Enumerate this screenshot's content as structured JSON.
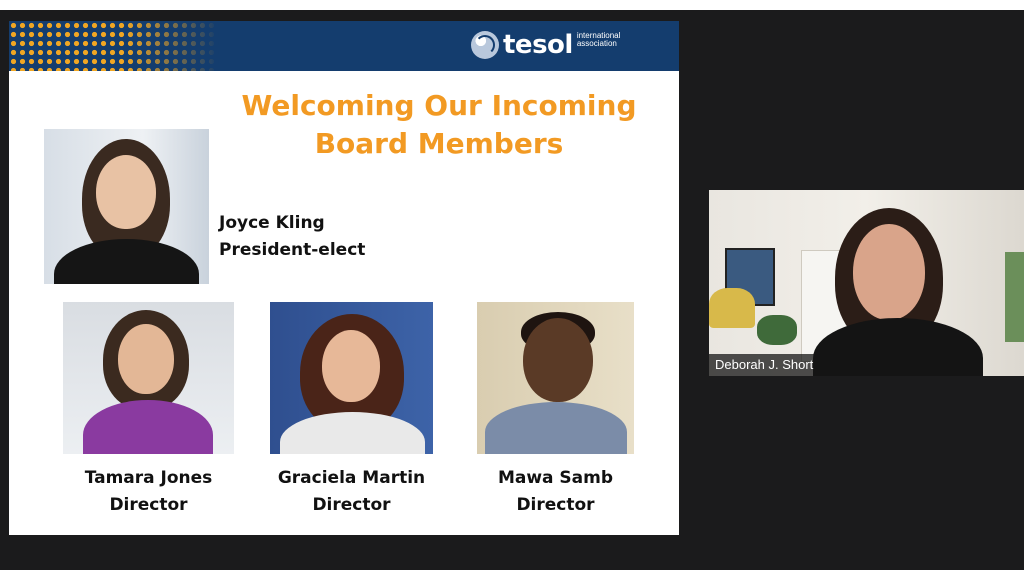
{
  "slide": {
    "logo": {
      "word": "tesol",
      "subtitle": "international association"
    },
    "title": "Welcoming Our Incoming Board Members",
    "featured": {
      "name": "Joyce Kling",
      "role": "President-elect"
    },
    "members": [
      {
        "name": "Tamara Jones",
        "role": "Director"
      },
      {
        "name": "Graciela Martin",
        "role": "Director"
      },
      {
        "name": "Mawa Samb",
        "role": "Director"
      }
    ],
    "colors": {
      "accent": "#f29a23",
      "banner": "#143d6e"
    }
  },
  "participant": {
    "name": "Deborah J. Short"
  }
}
